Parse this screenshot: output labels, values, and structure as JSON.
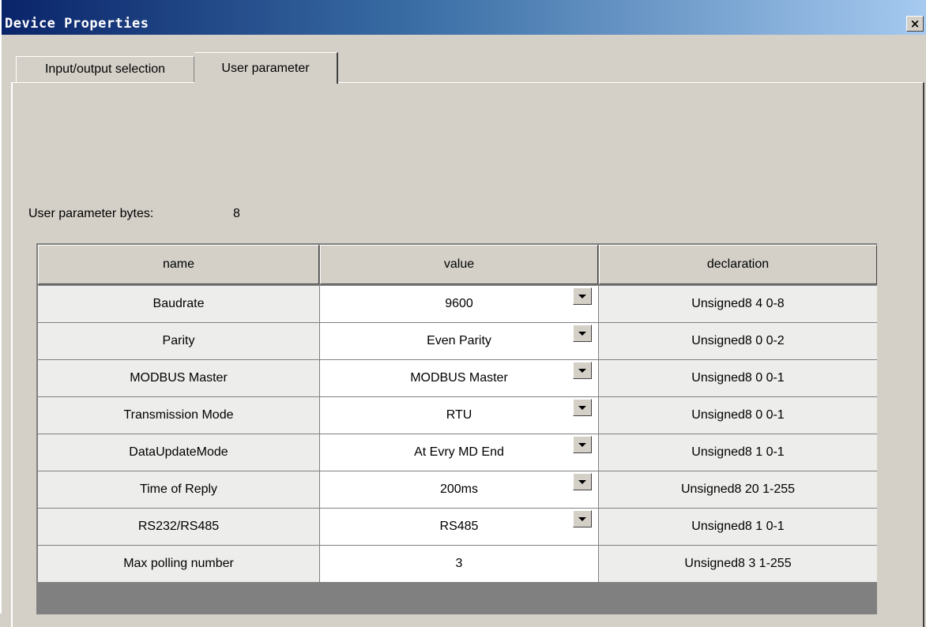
{
  "window": {
    "title": "Device Properties",
    "close_glyph": "×"
  },
  "tabs": [
    {
      "label": "Input/output selection"
    },
    {
      "label": "User parameter"
    }
  ],
  "user_parameter_bytes": {
    "label": "User parameter bytes:",
    "value": "8"
  },
  "table": {
    "headers": {
      "name": "name",
      "value": "value",
      "declaration": "declaration"
    },
    "rows": [
      {
        "name": "Baudrate",
        "value": "9600",
        "declaration": "Unsigned8 4 0-8"
      },
      {
        "name": "Parity",
        "value": "Even Parity",
        "declaration": "Unsigned8 0 0-2"
      },
      {
        "name": "MODBUS Master",
        "value": "MODBUS Master",
        "declaration": "Unsigned8 0 0-1"
      },
      {
        "name": "Transmission Mode",
        "value": "RTU",
        "declaration": "Unsigned8 0 0-1"
      },
      {
        "name": "DataUpdateMode",
        "value": "At Evry MD End",
        "declaration": "Unsigned8 1 0-1"
      },
      {
        "name": "Time of Reply",
        "value": "200ms",
        "declaration": "Unsigned8 20 1-255"
      },
      {
        "name": "RS232/RS485",
        "value": "RS485",
        "declaration": "Unsigned8 1 0-1"
      },
      {
        "name": "Max polling number",
        "value": "3",
        "declaration": "Unsigned8 3 1-255"
      }
    ]
  }
}
